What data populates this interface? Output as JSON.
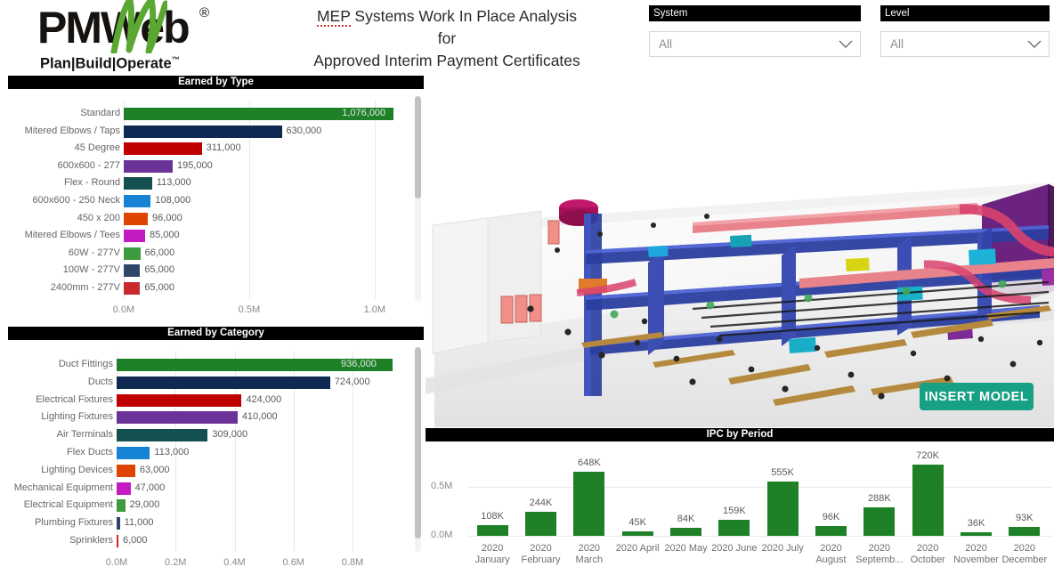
{
  "brand": {
    "logo_text": "PMWeb",
    "logo_registered": "®",
    "tagline": "Plan|Build|Operate",
    "tagline_tm": "™"
  },
  "header": {
    "title_line1_highlight": "MEP",
    "title_line1_rest": " Systems Work In Place Analysis for",
    "title_line2": "Approved Interim Payment Certificates"
  },
  "slicers": [
    {
      "label": "System",
      "value": "All",
      "icon": "chevron-down-icon"
    },
    {
      "label": "Level",
      "value": "All",
      "icon": "chevron-down-icon"
    }
  ],
  "model_viewer": {
    "insert_button_label": "INSERT MODEL"
  },
  "panels": {
    "earned_by_type": "Earned by Type",
    "earned_by_category": "Earned by Category",
    "ipc_by_period": "IPC by Period"
  },
  "colors": {
    "green": "#1e8128",
    "navy": "#0f2a52",
    "red": "#c00000",
    "purple": "#6b3397",
    "teal": "#14504f",
    "blue": "#1683d4",
    "orange": "#e04403",
    "magenta": "#c41ac4",
    "light_green": "#3e9a3e",
    "slate": "#2f4668",
    "brick": "#c9282d",
    "header_bg": "#000000",
    "accent_button": "#18a085"
  },
  "chart_data": [
    {
      "type": "bar",
      "orientation": "horizontal",
      "title": "Earned by Type",
      "xlabel": "",
      "ylabel": "",
      "xlim": [
        0,
        1100000
      ],
      "ticks": [
        "0.0M",
        "0.5M",
        "1.0M"
      ],
      "tick_values": [
        0,
        500000,
        1000000
      ],
      "grid": true,
      "categories": [
        "Standard",
        "Mitered Elbows / Taps",
        "45 Degree",
        "600x600 - 277",
        "Flex - Round",
        "600x600 - 250 Neck",
        "450 x 200",
        "Mitered Elbows / Tees",
        "60W - 277V",
        "100W - 277V",
        "2400mm - 277V"
      ],
      "values": [
        1076000,
        630000,
        311000,
        195000,
        113000,
        108000,
        96000,
        85000,
        66000,
        65000,
        65000
      ],
      "labels": [
        "1,076,000",
        "630,000",
        "311,000",
        "195,000",
        "113,000",
        "108,000",
        "96,000",
        "85,000",
        "66,000",
        "65,000",
        "65,000"
      ],
      "bar_colors": [
        "#1e8128",
        "#0f2a52",
        "#c00000",
        "#6b3397",
        "#14504f",
        "#1683d4",
        "#e04403",
        "#c41ac4",
        "#3e9a3e",
        "#2f4668",
        "#c9282d"
      ]
    },
    {
      "type": "bar",
      "orientation": "horizontal",
      "title": "Earned by Category",
      "xlabel": "",
      "ylabel": "",
      "xlim": [
        0,
        960000
      ],
      "ticks": [
        "0.0M",
        "0.2M",
        "0.4M",
        "0.6M",
        "0.8M"
      ],
      "tick_values": [
        0,
        200000,
        400000,
        600000,
        800000
      ],
      "grid": true,
      "categories": [
        "Duct Fittings",
        "Ducts",
        "Electrical Fixtures",
        "Lighting Fixtures",
        "Air Terminals",
        "Flex Ducts",
        "Lighting Devices",
        "Mechanical Equipment",
        "Electrical Equipment",
        "Plumbing Fixtures",
        "Sprinklers"
      ],
      "values": [
        936000,
        724000,
        424000,
        410000,
        309000,
        113000,
        63000,
        47000,
        29000,
        11000,
        6000
      ],
      "labels": [
        "936,000",
        "724,000",
        "424,000",
        "410,000",
        "309,000",
        "113,000",
        "63,000",
        "47,000",
        "29,000",
        "11,000",
        "6,000"
      ],
      "bar_colors": [
        "#1e8128",
        "#0f2a52",
        "#c00000",
        "#6b3397",
        "#14504f",
        "#1683d4",
        "#e04403",
        "#c41ac4",
        "#3e9a3e",
        "#2f4668",
        "#c9282d"
      ]
    },
    {
      "type": "bar",
      "orientation": "vertical",
      "title": "IPC by Period",
      "xlabel": "",
      "ylabel": "",
      "ylim": [
        0,
        760000
      ],
      "ticks": [
        "0.0M",
        "0.5M"
      ],
      "tick_values": [
        0,
        500000
      ],
      "grid": true,
      "series_color": "#1e8128",
      "categories": [
        "2020 January",
        "2020 February",
        "2020 March",
        "2020 April",
        "2020 May",
        "2020 June",
        "2020 July",
        "2020 August",
        "2020 Septemb...",
        "2020 October",
        "2020 November",
        "2020 December"
      ],
      "values": [
        108000,
        244000,
        648000,
        45000,
        84000,
        159000,
        555000,
        96000,
        288000,
        720000,
        36000,
        93000
      ],
      "labels": [
        "108K",
        "244K",
        "648K",
        "45K",
        "84K",
        "159K",
        "555K",
        "96K",
        "288K",
        "720K",
        "36K",
        "93K"
      ]
    }
  ]
}
